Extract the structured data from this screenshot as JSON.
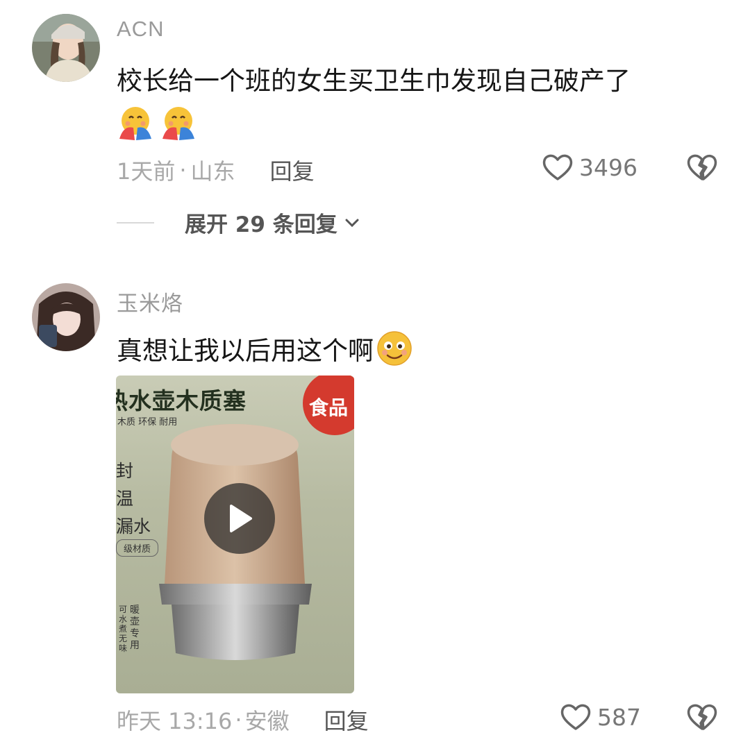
{
  "comments": [
    {
      "username": "ACN",
      "text": "校长给一个班的女生买卫生巾发现自己破产了",
      "emojis": [
        "hugging-face-emoji",
        "hugging-face-emoji"
      ],
      "time": "1天前",
      "location": "山东",
      "separator": "·",
      "reply_label": "回复",
      "likes": "3496",
      "expand_label": "展开 29 条回复"
    },
    {
      "username": "玉米烙",
      "text": "真想让我以后用这个啊",
      "emojis": [
        "grinning-face-emoji"
      ],
      "video": {
        "title": "热水壶木质塞",
        "subtitle": "木质 环保 耐用",
        "features": [
          "封",
          "温",
          "漏水"
        ],
        "material": "级材质",
        "badge": "食品",
        "vertical_left": "可水煮无味",
        "vertical_right": "暖壶专用"
      },
      "time": "昨天 13:16",
      "location": "安徽",
      "separator": "·",
      "reply_label": "回复",
      "likes": "587"
    }
  ],
  "colors": {
    "text_primary": "#161616",
    "text_muted": "#a8a8a8",
    "username": "#9a9a9a",
    "thumb_bg": "#b7bba2"
  }
}
